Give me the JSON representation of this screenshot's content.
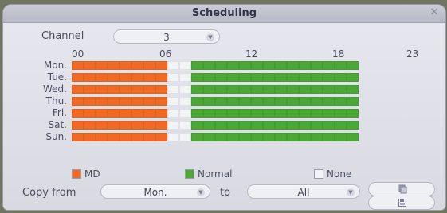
{
  "window": {
    "title": "Scheduling",
    "close_icon": "close-icon"
  },
  "channel": {
    "label": "Channel",
    "value": "3"
  },
  "hours": [
    "00",
    "06",
    "12",
    "18",
    "23"
  ],
  "days": [
    "Mon.",
    "Tue.",
    "Wed.",
    "Thu.",
    "Fri.",
    "Sat.",
    "Sun."
  ],
  "schedule": {
    "md_until_hour": 8,
    "none_from_hour": 9,
    "none_until_hour": 10,
    "normal_from_hour": 10,
    "total_hours": 24,
    "colors": {
      "md": "#ef6a24",
      "normal": "#4ca834",
      "none": "#f2f3f7"
    }
  },
  "legend": {
    "md": "MD",
    "normal": "Normal",
    "none": "None"
  },
  "copy": {
    "label": "Copy from",
    "from_value": "Mon.",
    "to_label": "to",
    "to_value": "All"
  },
  "buttons": {
    "copy_icon": "copy-icon",
    "save_icon": "save-icon"
  }
}
